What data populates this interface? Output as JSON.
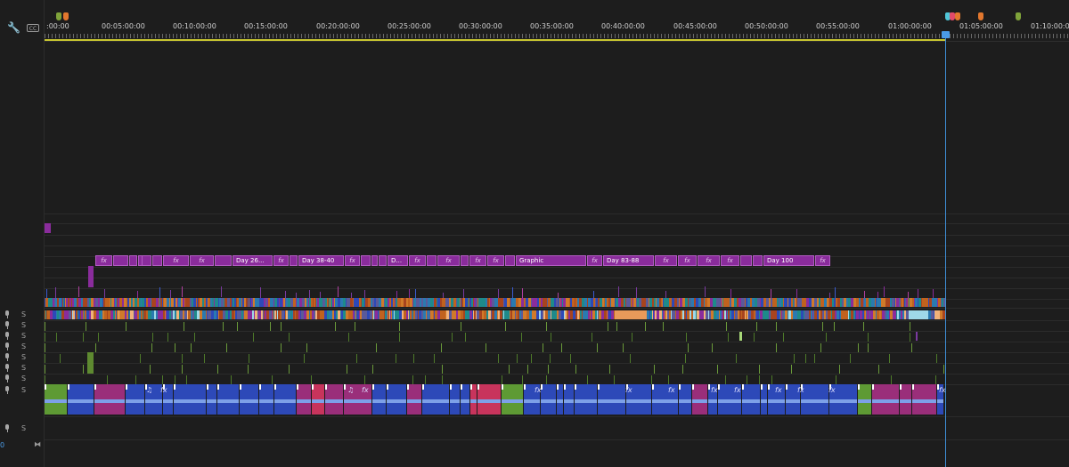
{
  "toolbar": {
    "wrench_icon": "wrench-icon",
    "captions_icon": "closed-captions-icon",
    "captions_label": "CC"
  },
  "ruler": {
    "timecodes": [
      ":00:00",
      "00:05:00:00",
      "00:10:00:00",
      "00:15:00:00",
      "00:20:00:00",
      "00:25:00:00",
      "00:30:00:00",
      "00:35:00:00",
      "00:40:00:00",
      "00:45:00:00",
      "00:50:00:00",
      "00:55:00:00",
      "01:00:00:00",
      "01:05:00:00",
      "01:10:00:00"
    ],
    "marker_colors": [
      "#7fa33a",
      "#e2772e",
      "#4fc6d8",
      "#e24a6a",
      "#e2772e",
      "#e2772e",
      "#7fa33a"
    ]
  },
  "colors": {
    "clip_purple": "#8a2c9c",
    "clip_blue": "#2d49b8",
    "clip_pink": "#c8345c",
    "clip_green": "#5e9a34",
    "clip_magenta": "#9a2e7a",
    "playhead": "#4a9be6",
    "work_area": "#c8c630"
  },
  "video_clips": [
    {
      "label": "fx"
    },
    {
      "label": ""
    },
    {
      "label": ""
    },
    {
      "label": ""
    },
    {
      "label": ""
    },
    {
      "label": ""
    },
    {
      "label": "fx"
    },
    {
      "label": "fx"
    },
    {
      "label": ""
    },
    {
      "label": "Day 26..."
    },
    {
      "label": "fx"
    },
    {
      "label": ""
    },
    {
      "label": "Day 38-40"
    },
    {
      "label": "fx"
    },
    {
      "label": ""
    },
    {
      "label": ""
    },
    {
      "label": ""
    },
    {
      "label": "D..."
    },
    {
      "label": "fx"
    },
    {
      "label": ""
    },
    {
      "label": "fx"
    },
    {
      "label": ""
    },
    {
      "label": "fx"
    },
    {
      "label": "fx"
    },
    {
      "label": ""
    },
    {
      "label": "Graphic"
    },
    {
      "label": "fx"
    },
    {
      "label": "Day 83-88"
    },
    {
      "label": "fx"
    },
    {
      "label": "fx"
    },
    {
      "label": "fx"
    },
    {
      "label": "fx"
    },
    {
      "label": ""
    },
    {
      "label": ""
    },
    {
      "label": "Day 100"
    },
    {
      "label": "fx"
    }
  ],
  "audio_tracks": [
    {
      "solo": "S"
    },
    {
      "solo": "S"
    },
    {
      "solo": "S"
    },
    {
      "solo": "S"
    },
    {
      "solo": "S"
    },
    {
      "solo": "S"
    },
    {
      "solo": "S"
    },
    {
      "solo": "S"
    },
    {
      "solo": "S"
    }
  ],
  "main_audio_labels": [
    "♫",
    "fx",
    "♫",
    "fx",
    "fx",
    "fx",
    "fx",
    "fx",
    "fx",
    "fx",
    "fx",
    "fx",
    "fx"
  ],
  "bottom": {
    "zoom_value": "0",
    "zoom_icon": "zoom-fit-icon"
  }
}
